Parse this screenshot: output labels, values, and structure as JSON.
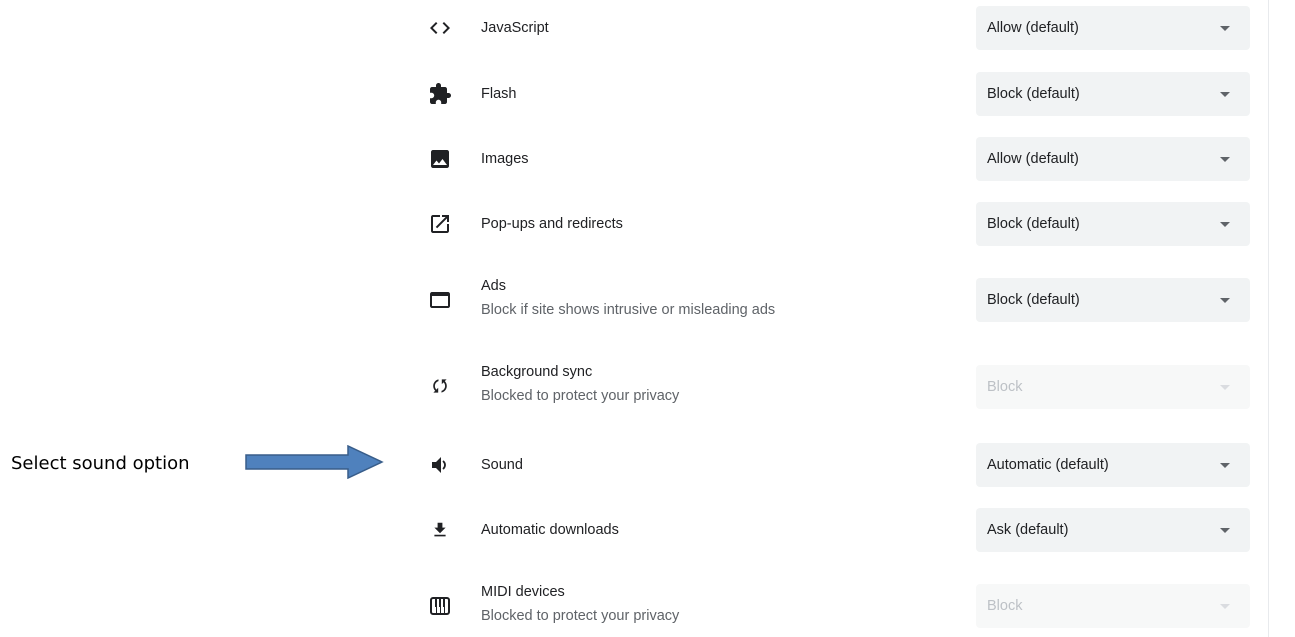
{
  "annotation": {
    "label": "Select sound option",
    "arrow_color": "#4f81bd"
  },
  "settings": [
    {
      "key": "javascript",
      "icon": "code-icon",
      "title": "JavaScript",
      "subtitle": "",
      "value": "Allow (default)",
      "disabled": false
    },
    {
      "key": "flash",
      "icon": "puzzle-piece-icon",
      "title": "Flash",
      "subtitle": "",
      "value": "Block (default)",
      "disabled": false
    },
    {
      "key": "images",
      "icon": "image-icon",
      "title": "Images",
      "subtitle": "",
      "value": "Allow (default)",
      "disabled": false
    },
    {
      "key": "popups",
      "icon": "open-in-new-icon",
      "title": "Pop-ups and redirects",
      "subtitle": "",
      "value": "Block (default)",
      "disabled": false
    },
    {
      "key": "ads",
      "icon": "web-window-icon",
      "title": "Ads",
      "subtitle": "Block if site shows intrusive or misleading ads",
      "value": "Block (default)",
      "disabled": false
    },
    {
      "key": "background-sync",
      "icon": "sync-icon",
      "title": "Background sync",
      "subtitle": "Blocked to protect your privacy",
      "value": "Block",
      "disabled": true
    },
    {
      "key": "sound",
      "icon": "volume-icon",
      "title": "Sound",
      "subtitle": "",
      "value": "Automatic (default)",
      "disabled": false
    },
    {
      "key": "automatic-downloads",
      "icon": "download-icon",
      "title": "Automatic downloads",
      "subtitle": "",
      "value": "Ask (default)",
      "disabled": false
    },
    {
      "key": "midi-devices",
      "icon": "piano-icon",
      "title": "MIDI devices",
      "subtitle": "Blocked to protect your privacy",
      "value": "Block",
      "disabled": true
    }
  ],
  "colors": {
    "icon": "#5f6368",
    "select_bg": "#f1f3f4",
    "disabled_text": "#bdc1c6"
  }
}
